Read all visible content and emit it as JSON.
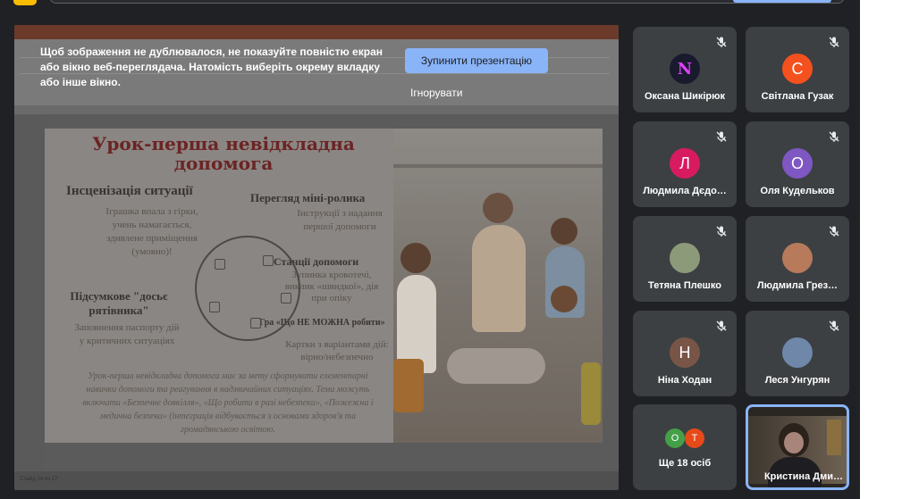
{
  "share_banner": {
    "message": "Щоб зображення не дублювалося, не показуйте повністю екран або вікно веб-переглядача. Натомість виберіть окрему вкладку або інше вікно.",
    "stop_label": "Зупинити презентацію",
    "ignore_label": "Ігнорувати"
  },
  "slide": {
    "title": "Урок-перша невідкладна допомога",
    "blocks": [
      {
        "heading": "Інсценізація ситуації",
        "text": "Іграшка впала з гірки, учень намагається, здивлене приміщення (умовно)!"
      },
      {
        "heading": "Перегляд міні-ролика",
        "text": "Інструкції з надання першої допомоги"
      },
      {
        "heading": "Станції допомоги",
        "text": "Зупинка кровотечі, виклик «швидкої», дія при опіку"
      },
      {
        "heading": "Підсумкове \"досьє рятівника\"",
        "text": "Заповнення паспорту дій у критичних ситуаціях"
      },
      {
        "heading": "Гра «Що НЕ МОЖНА робити»",
        "text": "Картки з варіантами дій: вірно/небезпечно"
      }
    ],
    "summary": "Урок-перша невідкладна допомога має за мету сформувати елементарні навички допомоги та реагування в надзвичайних ситуаціях. Теми можуть включати «Безпечне довкілля», «Що робити в разі небезпеки», «Пожежна і медична безпека» (інтеграція відбувається з основами здоров'я та громадянською освітою."
  },
  "ppt": {
    "status": "Слайд 14 из 17"
  },
  "participants": [
    {
      "name": "Оксана Шикірюк",
      "initial": "N",
      "color": "#1a1a2e",
      "muted": true
    },
    {
      "name": "Світлана Гузак",
      "initial": "С",
      "color": "#f4511e",
      "muted": true
    },
    {
      "name": "Людмила Дєдо…",
      "initial": "Л",
      "color": "#d81b60",
      "muted": true
    },
    {
      "name": "Оля Кудельков",
      "initial": "О",
      "color": "#7e57c2",
      "muted": true
    },
    {
      "name": "Тетяна Плешко",
      "initial": "",
      "color": "#8d9a7a",
      "muted": true
    },
    {
      "name": "Людмила Грез…",
      "initial": "",
      "color": "#b77a5a",
      "muted": true
    },
    {
      "name": "Ніна Ходан",
      "initial": "Н",
      "color": "#795548",
      "muted": true
    },
    {
      "name": "Леся Унгурян",
      "initial": "",
      "color": "#6f87a8",
      "muted": true
    }
  ],
  "more_tile": {
    "label": "Ще 18 осіб",
    "avatars": [
      {
        "initial": "О",
        "color": "#43a047"
      },
      {
        "initial": "Т",
        "color": "#e64a19"
      }
    ]
  },
  "self_tile": {
    "name": "Кристина Дми…"
  }
}
